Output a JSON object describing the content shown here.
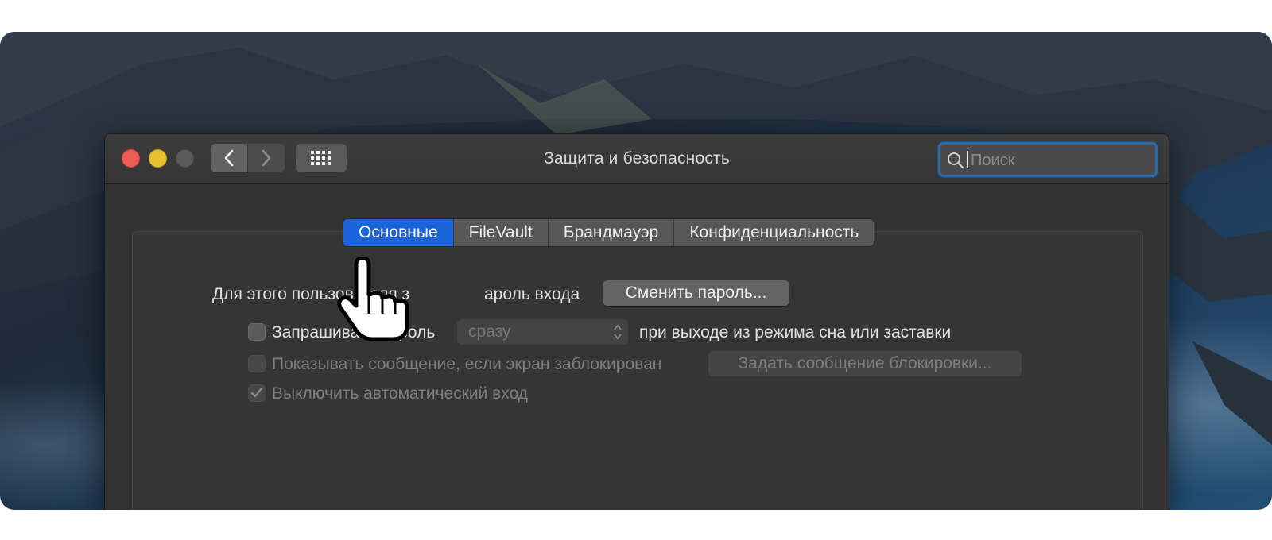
{
  "window": {
    "title": "Защита и безопасность"
  },
  "search": {
    "placeholder": "Поиск"
  },
  "tabs": [
    {
      "label": "Основные"
    },
    {
      "label": "FileVault"
    },
    {
      "label": "Брандмауэр"
    },
    {
      "label": "Конфиденциальность"
    }
  ],
  "general": {
    "password_label": "Для этого пользователя з",
    "password_label_tail": "ароль входа",
    "change_password_button": "Сменить пароль...",
    "require_password": {
      "label": "Запрашивать пароль",
      "checked": false,
      "delay_selected": "сразу",
      "suffix": "при выходе из режима сна или заставки"
    },
    "show_message": {
      "label": "Показывать сообщение, если экран заблокирован",
      "checked": false,
      "disabled": true,
      "button": "Задать сообщение блокировки..."
    },
    "disable_auto_login": {
      "label": "Выключить автоматический вход",
      "checked": true,
      "disabled": true
    }
  }
}
